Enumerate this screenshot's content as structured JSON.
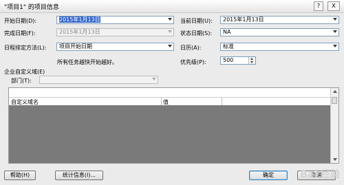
{
  "window": {
    "title": "\"项目1\" 的项目信息",
    "help_glyph": "?",
    "close_glyph": "X"
  },
  "form": {
    "start_date": {
      "label": "开始日期(D):",
      "value": "2015年1月13日"
    },
    "current_date": {
      "label": "当前日期(U):",
      "value": "2015年1月13日"
    },
    "finish_date": {
      "label": "完成日期(F):",
      "value": "2015年1月13日"
    },
    "status_date": {
      "label": "状态日期(S):",
      "value": "NA"
    },
    "schedule_from": {
      "label": "日程排定方法(L):",
      "value": "项目开始日期"
    },
    "calendar": {
      "label": "日历(A):",
      "value": "标准"
    },
    "note": "所有任务越快开始越好。",
    "priority": {
      "label": "优先级(P):",
      "value": "500"
    }
  },
  "custom_fields": {
    "group_label": "企业自定义域(E)",
    "department_label": "部门(T):",
    "department_value": "",
    "columns": [
      "自定义域名",
      "值"
    ]
  },
  "buttons": {
    "help": "帮助(H)",
    "statistics": "统计信息(I)...",
    "ok": "确定",
    "cancel": "取消"
  },
  "watermark": "Bai 经验"
}
